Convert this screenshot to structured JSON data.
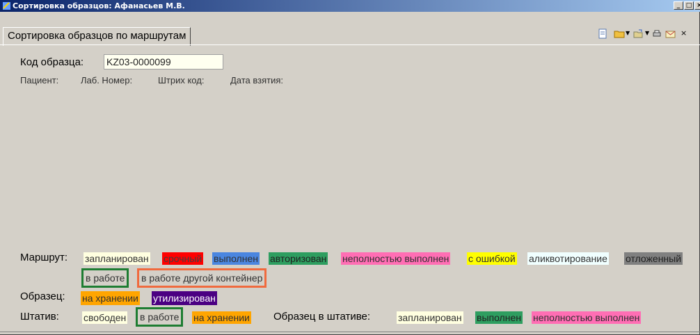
{
  "window": {
    "title": "Сортировка образцов: Афанасьев М.В."
  },
  "tab": {
    "label": "Сортировка образцов по маршрутам"
  },
  "sample_code": {
    "label": "Код образца:",
    "value": "KZ03-0000099"
  },
  "patient_info": {
    "patient_label": "Пациент:",
    "lab_number_label": "Лаб. Номер:",
    "barcode_label": "Штрих код:",
    "date_taken_label": "Дата взятия:"
  },
  "legend": {
    "route": {
      "label": "Маршрут:",
      "items": [
        {
          "text": "запланирован",
          "bg": "#ffffe0",
          "fg": "#303030"
        },
        {
          "text": "срочный",
          "bg": "#ff0000",
          "fg": "#404040"
        },
        {
          "text": "выполнен",
          "bg": "#4a86e0",
          "fg": "#303030"
        },
        {
          "text": "авторизован",
          "bg": "#2e9e60",
          "fg": "#202020"
        },
        {
          "text": "неполностью выполнен",
          "bg": "#ff6eb4",
          "fg": "#303030"
        },
        {
          "text": "с ошибкой",
          "bg": "#ffff00",
          "fg": "#303030"
        },
        {
          "text": "аликвотирование",
          "bg": "#f0ffff",
          "fg": "#303030"
        },
        {
          "text": "отложенный",
          "bg": "#808080",
          "fg": "#202020"
        }
      ],
      "items_row2": [
        {
          "text": "в работе",
          "bg": "#d4d0c8",
          "border": "#1e7d32"
        },
        {
          "text": "в работе другой контейнер",
          "bg": "#d4d0c8",
          "border": "#f06a3e"
        }
      ]
    },
    "sample": {
      "label": "Образец:",
      "items": [
        {
          "text": "на хранении",
          "bg": "#ffa500",
          "fg": "#303030"
        },
        {
          "text": "утилизирован",
          "bg": "#4b0082",
          "fg": "#ffffff"
        }
      ]
    },
    "rack": {
      "label": "Штатив:",
      "items": [
        {
          "text": "свободен",
          "bg": "#ffffe0",
          "fg": "#303030"
        },
        {
          "text": "в работе",
          "bg": "#d4d0c8",
          "border": "#1e7d32"
        },
        {
          "text": "на хранении",
          "bg": "#ffa500",
          "fg": "#303030"
        }
      ]
    },
    "sample_in_rack": {
      "label": "Образец в штативе:",
      "items": [
        {
          "text": "запланирован",
          "bg": "#ffffe0",
          "fg": "#303030"
        },
        {
          "text": "выполнен",
          "bg": "#2e9e60",
          "fg": "#202020"
        },
        {
          "text": "неполностью выполнен",
          "bg": "#ff6eb4",
          "fg": "#303030"
        }
      ]
    }
  },
  "toolbar_icons": [
    "document-icon",
    "folder-icon",
    "dropdown-arrow-icon",
    "open-icon",
    "dropdown-arrow-icon",
    "print-icon",
    "mail-icon",
    "close-icon"
  ]
}
